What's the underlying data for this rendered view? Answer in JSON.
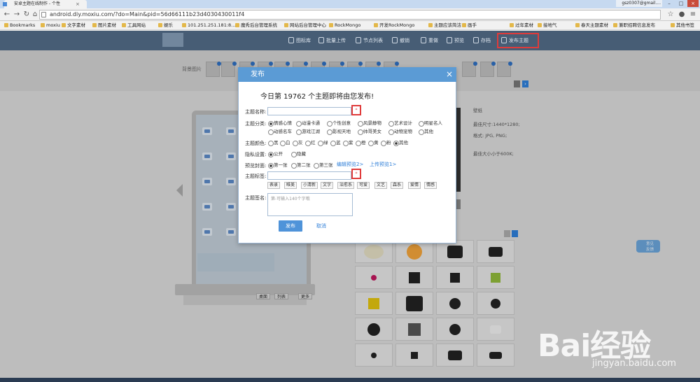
{
  "browser": {
    "tab_title": "安卓主题在线制作 - 个性",
    "user": "gsz0307@gmail....",
    "url": "android.diy.moxiu.com/?do=Main&pid=56d66111b23d4030430011f4",
    "bookmarks": [
      "Bookmarks",
      "moxiu",
      "文字素材",
      "图片素材",
      "工具网站",
      "娱乐",
      "101.251.251.181:8...",
      "魔秀后台管理系统",
      "网站后台管理中心",
      "RockMongo",
      "开发RockMongo",
      "主题应该简洁",
      "画手",
      "过年素材",
      "接地气",
      "春天主题素材",
      "兼职招聘信息发布"
    ],
    "other_bookmarks": "其他书签"
  },
  "header": {
    "items": [
      "图标库",
      "批量上传",
      "节点列表",
      "撤销",
      "重做",
      "预览",
      "存档",
      "发布主题"
    ]
  },
  "page": {
    "wallpaper_label": "背景图片",
    "info_title": "壁纸",
    "info_lines": [
      "最佳尺寸:1440*1280;",
      "格式: JPG, PNG;",
      "最佳大小小于600K;"
    ],
    "phone_tabs": [
      "桌面",
      "列表",
      "更多"
    ],
    "feedback": [
      "意见",
      "反馈"
    ]
  },
  "dialog": {
    "title": "发布",
    "headline": "今日第 19762 个主题即将由您发布!",
    "name_label": "主题名称:",
    "category_label": "主题分类:",
    "categories": [
      "情感心情",
      "动漫卡通",
      "个性创意",
      "风景静物",
      "艺术设计",
      "明星名人",
      "动感名车",
      "游戏江湖",
      "影视天地",
      "帅哥美女",
      "动物宠物",
      "其他"
    ],
    "color_label": "主题颜色:",
    "colors": [
      "黑",
      "白",
      "灰",
      "红",
      "绿",
      "蓝",
      "紫",
      "橙",
      "黄",
      "粉",
      "其他"
    ],
    "privacy_label": "隐私设置:",
    "privacy": [
      "公开",
      "隐藏"
    ],
    "cover_label": "预览封面:",
    "covers": [
      "第一张",
      "第二张",
      "第三张"
    ],
    "edit_preview": "编辑预览2>",
    "upload_preview": "上传预览1>",
    "tags_label": "主题标签:",
    "tags": [
      "表录",
      "唯美",
      "小清新",
      "文字",
      "治愈系",
      "可爱",
      "文艺",
      "森系",
      "爱情",
      "情感"
    ],
    "signature_label": "主题签名:",
    "signature_placeholder": "第-可输入140个字哦",
    "required_mark": "*",
    "publish_button": "发布",
    "cancel_button": "取消"
  },
  "watermark": {
    "text": "Bai经验",
    "url": "jingyan.baidu.com"
  },
  "colors": {
    "header": "#475d75",
    "dialog_head": "#5b9bd5",
    "highlight": "#e03b3b",
    "button": "#4f93d9"
  }
}
